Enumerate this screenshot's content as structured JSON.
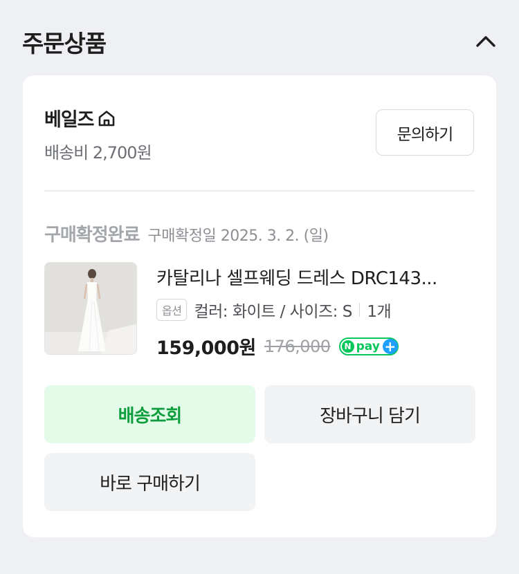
{
  "section": {
    "title": "주문상품",
    "collapse_icon": "chevron-up-icon"
  },
  "seller": {
    "name": "베일즈",
    "store_icon": "store-home-icon",
    "shipping_fee": "배송비 2,700원",
    "inquiry_label": "문의하기"
  },
  "order": {
    "status_label": "구매확정완료",
    "status_date": "구매확정일 2025. 3. 2. (일)"
  },
  "product": {
    "name": "카탈리나 셀프웨딩 드레스 DRC143...",
    "option_badge": "옵션",
    "option_text": "컬러: 화이트 / 사이즈: S",
    "quantity": "1개",
    "price": "159,000원",
    "original_price": "176,000",
    "npay_label": "pay",
    "npay_n": "N",
    "npay_plus": "+"
  },
  "actions": {
    "track_label": "배송조회",
    "cart_label": "장바구니 담기",
    "buy_label": "바로 구매하기"
  },
  "colors": {
    "accent_green": "#0e9e3d",
    "npay_green": "#03c75a",
    "npay_blue": "#1ea0ff"
  }
}
